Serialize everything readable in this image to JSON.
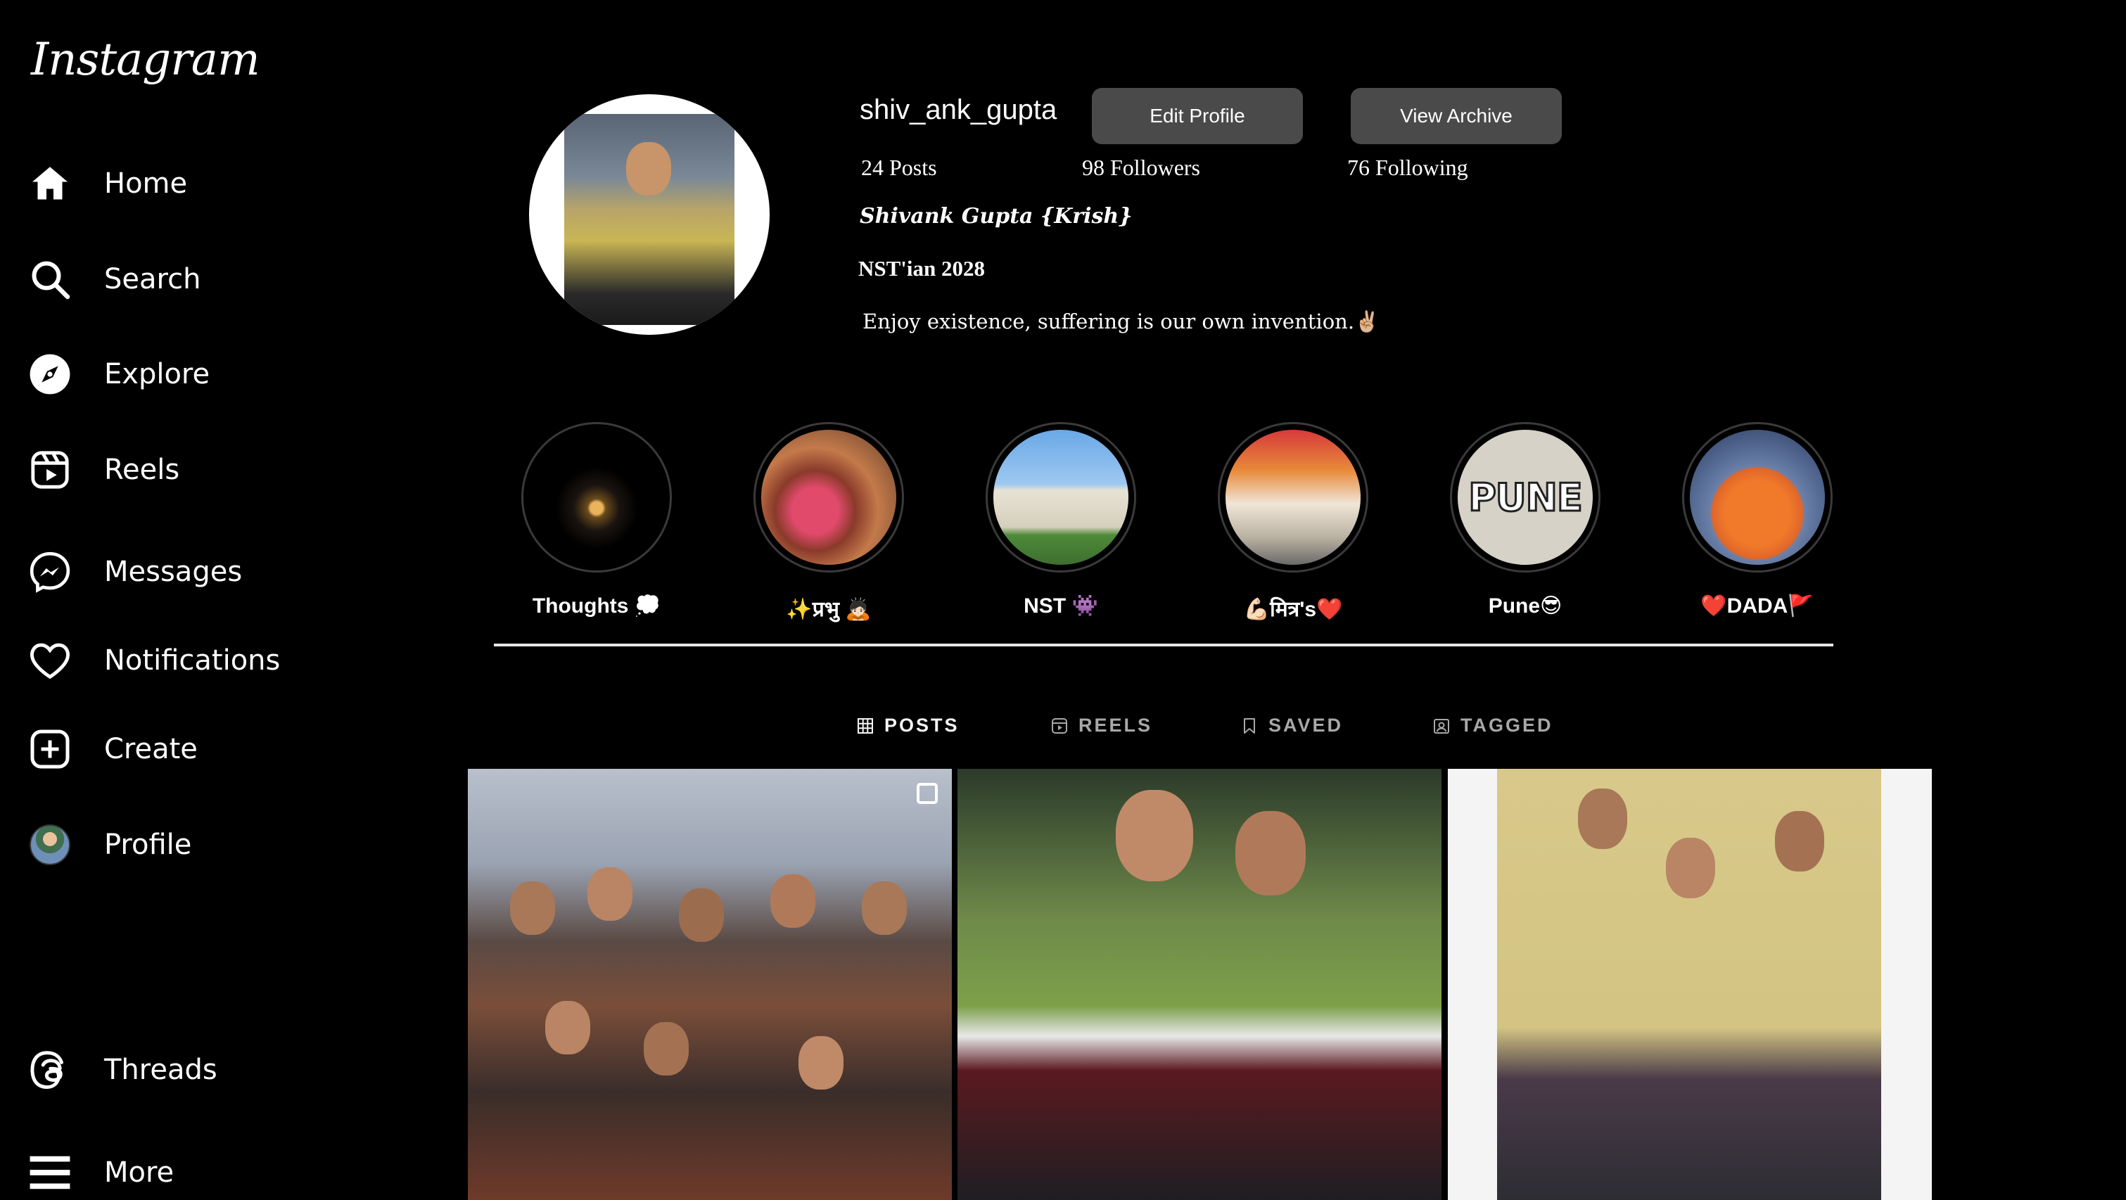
{
  "app": {
    "logo": "Instagram"
  },
  "sidebar": {
    "items": [
      {
        "label": "Home",
        "icon": "home-icon"
      },
      {
        "label": "Search",
        "icon": "search-icon"
      },
      {
        "label": "Explore",
        "icon": "compass-icon"
      },
      {
        "label": "Reels",
        "icon": "reels-icon"
      },
      {
        "label": "Messages",
        "icon": "messenger-icon"
      },
      {
        "label": "Notifications",
        "icon": "heart-icon"
      },
      {
        "label": "Create",
        "icon": "plus-square-icon"
      },
      {
        "label": "Profile",
        "icon": "avatar"
      },
      {
        "label": "Threads",
        "icon": "threads-icon"
      },
      {
        "label": "More",
        "icon": "menu-icon"
      }
    ]
  },
  "profile": {
    "username": "shiv_ank_gupta",
    "edit_label": "Edit Profile",
    "archive_label": "View Archive",
    "posts": "24 Posts",
    "followers": "98 Followers",
    "following": "76 Following",
    "full_name": "Shivank Gupta {Krish}",
    "tagline": "NST'ian 2028",
    "bio": "Enjoy existence, suffering is our own invention.✌🏼"
  },
  "highlights": [
    {
      "label": "Thoughts 💭"
    },
    {
      "label": "✨प्रभु 🙇🏻"
    },
    {
      "label": "NST 👾"
    },
    {
      "label": "💪🏻मित्र's❤️"
    },
    {
      "label": "Pune😎"
    },
    {
      "label": "❤️DADA🚩"
    }
  ],
  "tabs": [
    {
      "label": "POSTS",
      "icon": "grid-icon",
      "active": true
    },
    {
      "label": "REELS",
      "icon": "reels-icon",
      "active": false
    },
    {
      "label": "SAVED",
      "icon": "bookmark-icon",
      "active": false
    },
    {
      "label": "TAGGED",
      "icon": "tag-user-icon",
      "active": false
    }
  ],
  "colors": {
    "background": "#000000",
    "button": "#4a4a4a",
    "text": "#ffffff",
    "muted": "#a8a8a8"
  }
}
